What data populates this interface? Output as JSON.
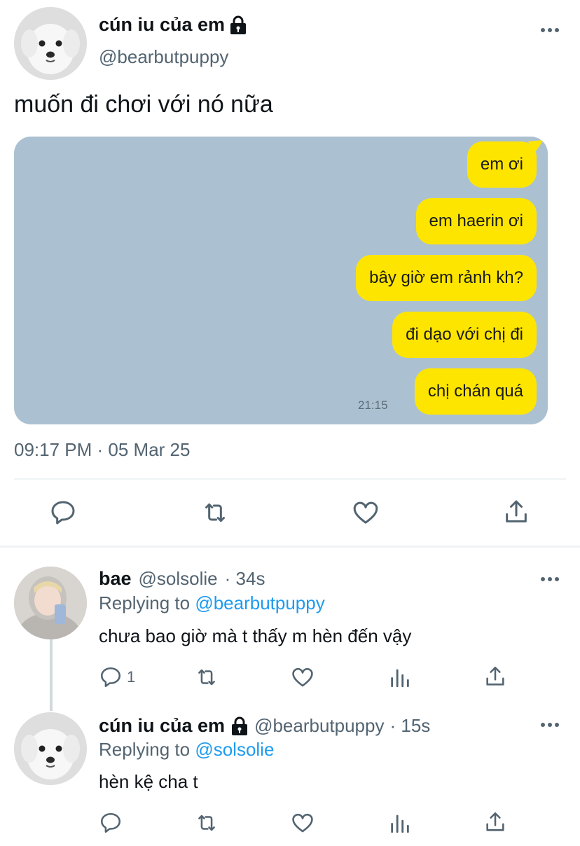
{
  "tweet": {
    "author_name": "cún iu của em",
    "author_handle": "@bearbutpuppy",
    "text": "muốn đi chơi với nó nữa",
    "timestamp": "09:17 PM · 05 Mar 25",
    "protected_icon": "lock-icon",
    "image": {
      "background_color": "#abc1d1",
      "bubble_color": "#fee500",
      "messages": [
        "em ơi",
        "em haerin ơi",
        "bây giờ em rảnh kh?",
        "đi dạo với chị đi",
        "chị chán quá"
      ],
      "time": "21:15"
    },
    "actions": [
      "reply-icon",
      "retweet-icon",
      "like-icon",
      "share-icon"
    ]
  },
  "replies": [
    {
      "author_name": "bae",
      "author_handle": "@solsolie",
      "age": "· 34s",
      "replying_label": "Replying to",
      "replying_to": "@bearbutpuppy",
      "text": "chưa bao giờ mà t thấy m hèn đến vậy",
      "reply_count": "1"
    },
    {
      "author_name": "cún iu của em",
      "author_handle": "@bearbutpuppy",
      "age": "· 15s",
      "replying_label": "Replying to",
      "replying_to": "@solsolie",
      "text": "hèn kệ cha t",
      "reply_count": ""
    }
  ],
  "colors": {
    "accent": "#1d9bf0",
    "secondary_text": "#536471",
    "divider": "#eff3f4"
  }
}
